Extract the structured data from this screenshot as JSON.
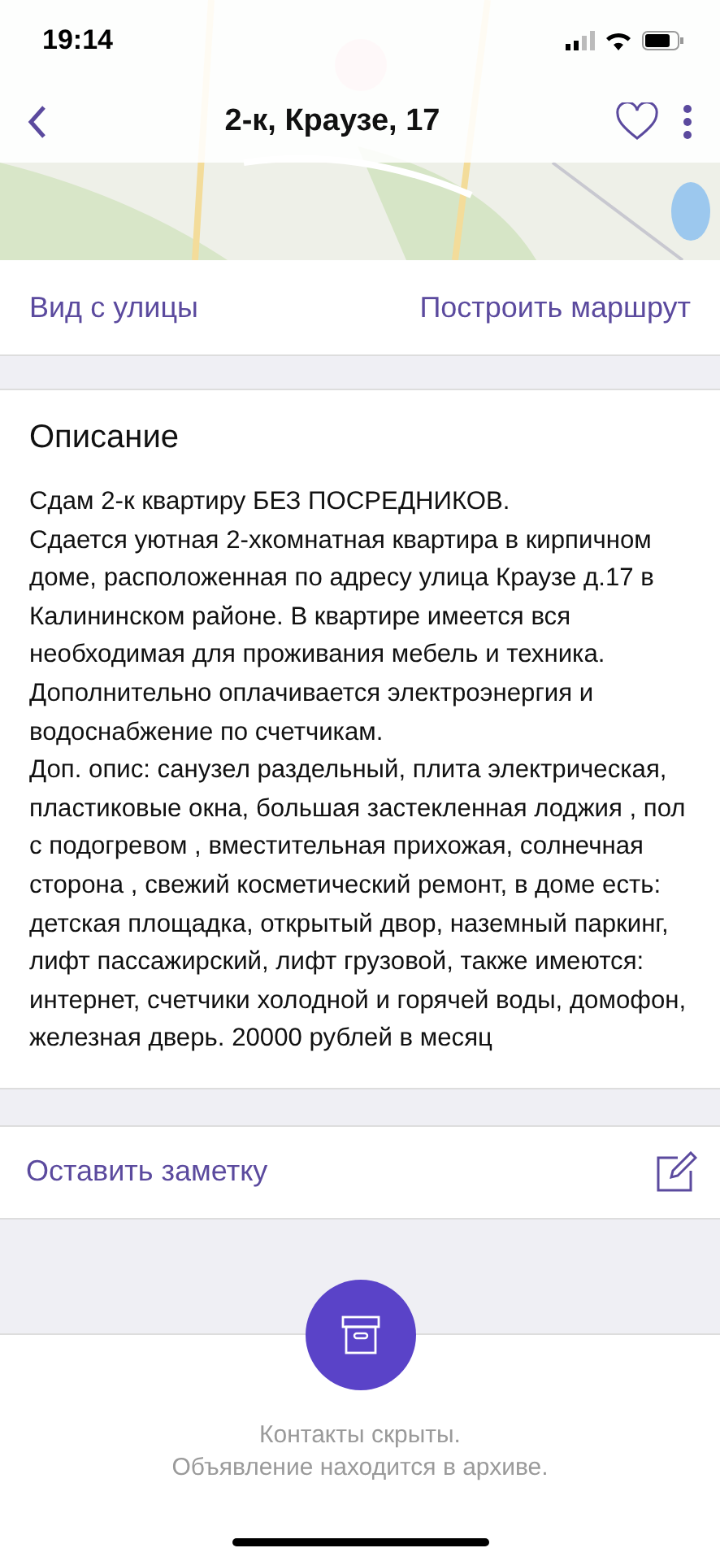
{
  "status_bar": {
    "time": "19:14"
  },
  "nav": {
    "title": "2-к, Краузе, 17",
    "favorite": false
  },
  "map_links": [
    "Вид с улицы",
    "Построить маршрут"
  ],
  "description": {
    "title": "Описание",
    "text": "Сдам 2-к квартиру БЕЗ ПОСРЕДНИКОВ.\nСдается уютная 2-хкомнатная квартира в кирпичном доме, расположенная по адресу улица Краузе д.17 в Калининском районе. В квартире имеется вся необходимая для проживания мебель и техника.\nДополнительно оплачивается электроэнергия и водоснабжение по счетчикам.\nДоп. опис: санузел раздельный, плита электрическая, пластиковые окна, большая застекленная лоджия , пол с подогревом , вместительная прихожая, солнечная сторона , свежий косметический ремонт, в доме есть: детская площадка, открытый двор, наземный паркинг, лифт пассажирский, лифт грузовой, также имеются: интернет, счетчики холодной и горячей воды, домофон, железная дверь. 20000 рублей в месяц"
  },
  "note": {
    "label": "Оставить заметку"
  },
  "archive": {
    "lines": [
      "Контакты скрыты.",
      "Объявление находится в архиве."
    ]
  }
}
